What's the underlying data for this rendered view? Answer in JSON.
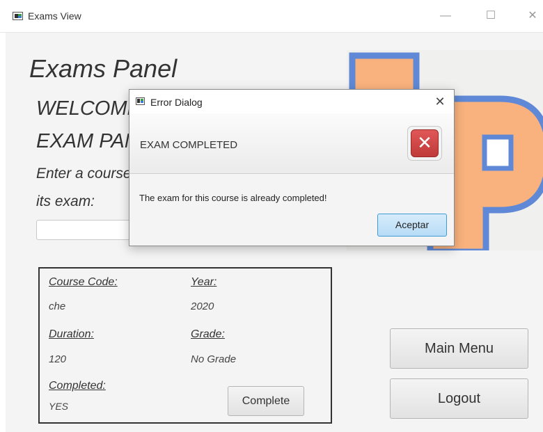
{
  "window": {
    "title": "Exams View",
    "minimize_icon": "minimize-icon",
    "maximize_icon": "maximize-icon",
    "close_icon": "close-icon"
  },
  "main": {
    "panel_title": "Exams Panel",
    "welcome_line1": "WELCOME TO THE",
    "welcome_line2": "EXAM PANEL",
    "instruction_line1": "Enter a course code to see",
    "instruction_line2": "its exam:",
    "course_input_value": "",
    "logo_letters": "UP",
    "logo_colors": {
      "fill": "#f9b27d",
      "outline": "#5f89d6"
    }
  },
  "exam_info": {
    "course_code_label": "Course Code:",
    "course_code_value": "che",
    "year_label": "Year:",
    "year_value": "2020",
    "duration_label": "Duration:",
    "duration_value": "120",
    "grade_label": "Grade:",
    "grade_value": "No Grade",
    "completed_label": "Completed:",
    "completed_value": "YES",
    "complete_button": "Complete"
  },
  "nav": {
    "main_menu_button": "Main Menu",
    "logout_button": "Logout"
  },
  "dialog": {
    "title": "Error Dialog",
    "close_icon": "close-icon",
    "header_text": "EXAM COMPLETED",
    "error_icon": "error-x-icon",
    "message": "The exam for this course is already completed!",
    "accept_button": "Aceptar",
    "colors": {
      "error_red": "#d24a4a",
      "accept_border": "#3e9ad6"
    }
  }
}
